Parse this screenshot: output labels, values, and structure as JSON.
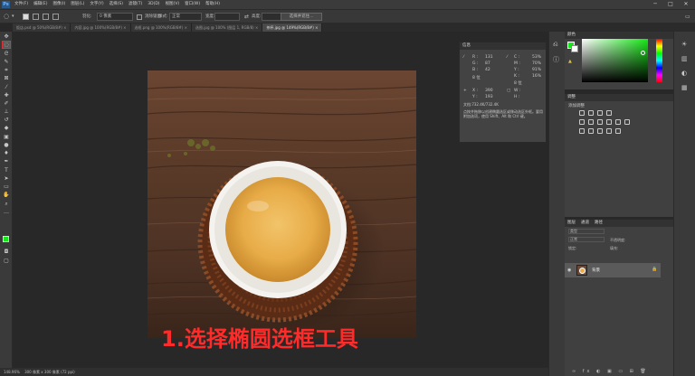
{
  "menubar": {
    "logo": "Ps",
    "items": [
      "文件(F)",
      "编辑(E)",
      "图像(I)",
      "图层(L)",
      "文字(Y)",
      "选择(S)",
      "滤镜(T)",
      "3D(D)",
      "视图(V)",
      "窗口(W)",
      "帮助(H)"
    ],
    "minimize": "─",
    "maximize": "□",
    "close": "✕"
  },
  "options": {
    "feather_label": "羽化:",
    "feather_value": "0 像素",
    "antialias_label": "消除锯齿",
    "style_label": "样式:",
    "style_value": "正常",
    "width_label": "宽度:",
    "height_label": "高度:",
    "select_mask_button": "选择并遮住..."
  },
  "tabs": [
    {
      "label": "饭店.psd @ 50%(RGB/8#) ×",
      "active": false
    },
    {
      "label": "内容.jpg @ 100%(RGB/8#) ×",
      "active": false
    },
    {
      "label": "选框.png @ 100%(RGB/8#) ×",
      "active": false
    },
    {
      "label": "选图.jpg @ 100% (图层 1, RGB/8) ×",
      "active": false
    },
    {
      "label": "茶杯.jpg @ 149%(RGB/8#) ×",
      "active": true
    }
  ],
  "info_panel": {
    "title": "信息",
    "r_label": "R :",
    "r_value": "131",
    "g_label": "G :",
    "g_value": "87",
    "b_label": "B :",
    "b_value": "42",
    "c_label": "C :",
    "c_value": "53%",
    "m_label": "M :",
    "m_value": "70%",
    "y_label": "Y :",
    "y_value": "91%",
    "k_label": "K :",
    "k_value": "16%",
    "bits_left": "8 位",
    "bits_right": "8 位",
    "x_label": "X :",
    "x_value": "390",
    "y2_label": "Y :",
    "y2_value": "193",
    "w_label": "W :",
    "h_label": "H :",
    "doc_size": "文档:732.4K/732.4K",
    "hint": "点按并拖移以创建椭圆选区或移动选区外框。要用附加选项，使用 Shift、Alt 和 Ctrl 键。"
  },
  "color_panel": {
    "title": "颜色"
  },
  "adjust_panel": {
    "title": "调整",
    "subtitle": "添加调整"
  },
  "layers_panel": {
    "tabs": [
      "图层",
      "通道",
      "路径"
    ],
    "kind_label": "类型",
    "blend_mode": "正常",
    "opacity_label": "不透明度:",
    "lock_label": "锁定:",
    "fill_label": "填充:",
    "layer_name": "背景"
  },
  "status": {
    "zoom": "148.96%",
    "doc_info": "300 像素 x 300 像素 (72 ppi)"
  },
  "caption": "1.选择椭圆选框工具",
  "colors": {
    "foreground": "#17e817",
    "caption": "#ff2a2a"
  }
}
